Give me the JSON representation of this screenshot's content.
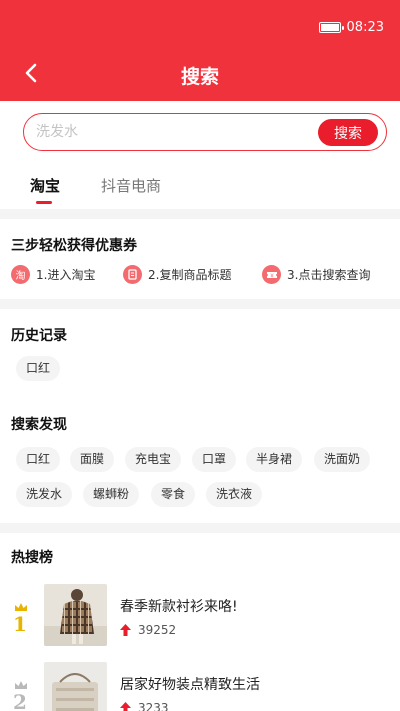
{
  "status_bar": {
    "time": "08:23",
    "icons": [
      "battery-icon"
    ]
  },
  "header": {
    "title": "搜索",
    "back_icon": "back-chevron-icon"
  },
  "search": {
    "placeholder": "洗发水",
    "value": "",
    "button_label": "搜索"
  },
  "tabs": [
    {
      "label": "淘宝",
      "active": true
    },
    {
      "label": "抖音电商",
      "active": false
    }
  ],
  "guide": {
    "title": "三步轻松获得优惠券",
    "steps": [
      {
        "icon_text": "淘",
        "label": "1.进入淘宝",
        "icon": "taobao-icon"
      },
      {
        "icon_text": "",
        "label": "2.复制商品标题",
        "icon": "copy-icon"
      },
      {
        "icon_text": "",
        "label": "3.点击搜索查询",
        "icon": "coupon-icon"
      }
    ]
  },
  "history": {
    "title": "历史记录",
    "items": [
      "口红"
    ]
  },
  "discover": {
    "title": "搜索发现",
    "items": [
      "口红",
      "面膜",
      "充电宝",
      "口罩",
      "半身裙",
      "洗面奶",
      "洗发水",
      "螺蛳粉",
      "零食",
      "洗衣液"
    ]
  },
  "hot": {
    "title": "热搜榜",
    "items": [
      {
        "rank": "1",
        "title": "春季新款衬衫来咯!",
        "count": "39252",
        "rank_color": "#e8b400",
        "image": "plaid-coat-photo"
      },
      {
        "rank": "2",
        "title": "居家好物装点精致生活",
        "count": "3233",
        "rank_color": "#b9b9b9",
        "image": "home-goods-photo"
      }
    ]
  },
  "colors": {
    "brand_red": "#f0323c",
    "button_red": "#e91d2b",
    "gold": "#e8b400",
    "silver": "#b9b9b9"
  }
}
